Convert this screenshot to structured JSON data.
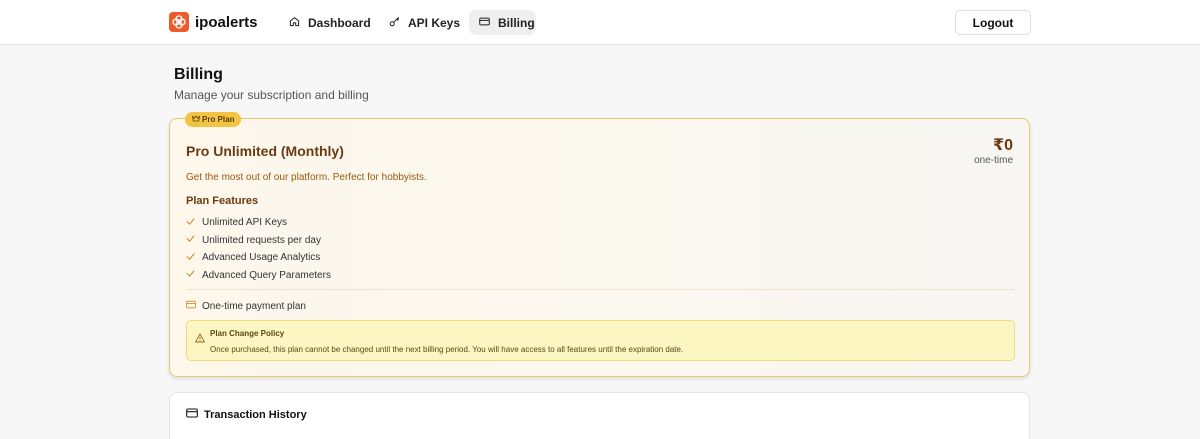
{
  "app": {
    "brand_name": "ipoalerts",
    "brand_color": "#ef5a2a",
    "logo_icon": "flower-logo-icon"
  },
  "nav": {
    "items": [
      {
        "label": "Dashboard",
        "icon": "home-icon",
        "active": false
      },
      {
        "label": "API Keys",
        "icon": "key-icon",
        "active": false
      },
      {
        "label": "Billing",
        "icon": "credit-card-icon",
        "active": true
      }
    ],
    "logout_label": "Logout"
  },
  "page": {
    "title": "Billing",
    "subtitle": "Manage your subscription and billing"
  },
  "plan": {
    "badge_label": "Pro Plan",
    "badge_icon": "crown-icon",
    "name": "Pro Unlimited (Monthly)",
    "price": "₹0",
    "period": "one-time",
    "description": "Get the most out of our platform. Perfect for hobbyists.",
    "features_title": "Plan Features",
    "features": [
      "Unlimited API Keys",
      "Unlimited requests per day",
      "Advanced Usage Analytics",
      "Advanced Query Parameters"
    ],
    "payment_type": "One-time payment plan",
    "policy": {
      "title": "Plan Change Policy",
      "text": "Once purchased, this plan cannot be changed until the next billing period. You will have access to all features until the expiration date.",
      "icon": "warning-triangle-icon"
    },
    "accent_color": "#e8c877",
    "badge_color": "#f3c443"
  },
  "transactions": {
    "title": "Transaction History",
    "icon": "credit-card-icon"
  }
}
